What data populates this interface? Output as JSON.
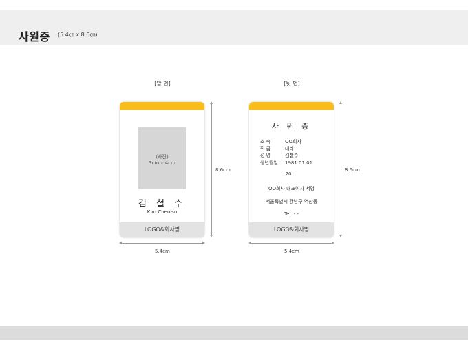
{
  "page": {
    "title": "사원증",
    "subtitle": "(5.4㎝ x 8.6㎝)"
  },
  "front": {
    "side_label": "[앞  면]",
    "photo_line1": "(사진)",
    "photo_line2": "3cm x 4cm",
    "name_ko": "김 철 수",
    "name_en": "Kim Cheolsu",
    "footer": "LOGO&회사명"
  },
  "back": {
    "side_label": "[뒷  면]",
    "title": "사 원 증",
    "fields": [
      {
        "label": "소  속",
        "value": "OO회사"
      },
      {
        "label": "직  급",
        "value": "대리"
      },
      {
        "label": "성  명",
        "value": "김철수"
      },
      {
        "label": "생년월일",
        "value": "1981.01.01"
      }
    ],
    "date_line": "20 .   .",
    "signature": "OO회사 대표이사 서명",
    "address": "서울특별시 강남구 역삼동",
    "tel": "Tel.   -   -",
    "footer": "LOGO&회사명"
  },
  "dimensions": {
    "height_label": "8.6cm",
    "width_label": "5.4cm"
  },
  "colors": {
    "accent": "#f8bd1a",
    "footer_gray": "#e3e3e3",
    "photo_gray": "#d6d6d6"
  }
}
